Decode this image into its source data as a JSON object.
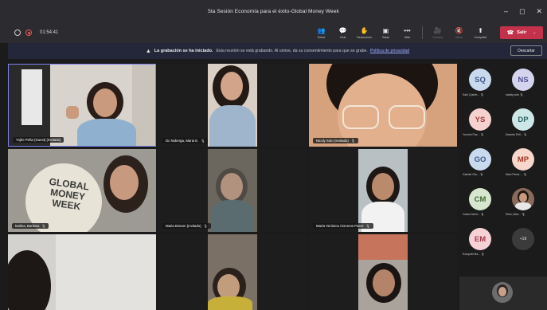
{
  "window": {
    "title": "5ta Sesión Economía para el éxito-Global Money Week",
    "controls": [
      "–",
      "◻",
      "✕"
    ]
  },
  "toolbar": {
    "timer": "01:54:41",
    "buttons": [
      {
        "icon": "people-icon",
        "glyph": "👥",
        "label": "Gente",
        "enabled": true
      },
      {
        "icon": "chat-icon",
        "glyph": "💬",
        "label": "Chat",
        "enabled": true
      },
      {
        "icon": "reactions-icon",
        "glyph": "✋",
        "label": "Reacciones",
        "enabled": true
      },
      {
        "icon": "rooms-icon",
        "glyph": "▣",
        "label": "Salas",
        "enabled": true
      },
      {
        "icon": "more-icon",
        "glyph": "•••",
        "label": "Más",
        "enabled": true
      },
      {
        "icon": "camera-icon",
        "glyph": "🎥",
        "label": "Cámara",
        "enabled": false
      },
      {
        "icon": "mic-icon",
        "glyph": "🔇",
        "label": "Micro",
        "enabled": false
      },
      {
        "icon": "share-icon",
        "glyph": "⬆",
        "label": "Compartir",
        "enabled": true
      }
    ],
    "leave_label": "Salir",
    "leave_color": "#c4314b"
  },
  "banner": {
    "bold": "La grabación se ha iniciado.",
    "message": "Esta reunión se está grabando. Al unirse, da su consentimiento para que se grabe.",
    "link": "Política de privacidad",
    "dismiss": "Descartar"
  },
  "participants_video": [
    {
      "name": "Yojhe Peña (Guest) (Invitado)",
      "muted": false
    },
    {
      "name": "Dc Noberga, Maria E.",
      "muted": true
    },
    {
      "name": "Nicoly Soto (Invitado)",
      "muted": true
    },
    {
      "name": "Molina, Barbara",
      "muted": true
    },
    {
      "name": "Maria Brazon (Invitado)",
      "muted": true
    },
    {
      "name": "María Verónica Cisneros Pacre",
      "muted": true
    },
    {
      "name": "",
      "muted": false
    },
    {
      "name": "",
      "muted": false
    },
    {
      "name": "",
      "muted": false
    }
  ],
  "poster_text": [
    "GLOBAL",
    "MONEY",
    "WEEK"
  ],
  "roster": [
    {
      "initials": "SQ",
      "name": "Saúl Quinte...",
      "style": "av-sq"
    },
    {
      "initials": "NS",
      "name": "nataly soto",
      "style": "av-ns"
    },
    {
      "initials": "YS",
      "name": "Yorchei Paz...",
      "style": "av-ys"
    },
    {
      "initials": "DP",
      "name": "Daniela Pell...",
      "style": "av-dp"
    },
    {
      "initials": "GO",
      "name": "Gabriel Oto...",
      "style": "av-go"
    },
    {
      "initials": "MP",
      "name": "Maxi Pérez ...",
      "style": "av-mp"
    },
    {
      "initials": "CM",
      "name": "Carlos Mont...",
      "style": "av-cm"
    },
    {
      "initials": "",
      "name": "Silva, Aldo...",
      "style": "av-photo"
    },
    {
      "initials": "EM",
      "name": "Ezequiel Ma...",
      "style": "av-em"
    },
    {
      "initials": "+18",
      "name": "",
      "style": "av-more"
    }
  ]
}
